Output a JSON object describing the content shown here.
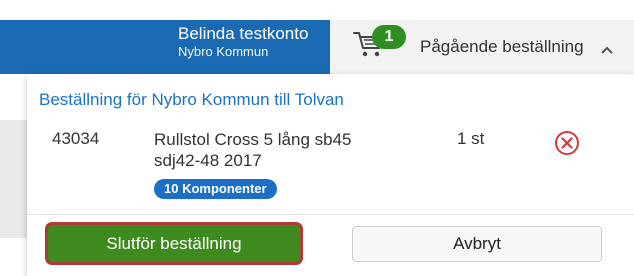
{
  "header": {
    "account_name": "Belinda testkonto",
    "account_org": "Nybro Kommun",
    "cart_count": "1",
    "order_status": "Pågående beställning",
    "accent_color": "#1a6ab3"
  },
  "order": {
    "title": "Beställning för Nybro Kommun till Tolvan",
    "items": [
      {
        "id": "43034",
        "description": "Rullstol Cross 5 lång sb45 sdj42-48 2017",
        "quantity": "1 st",
        "components": "10 Komponenter"
      }
    ],
    "actions": {
      "complete_label": "Slutför beställning",
      "cancel_label": "Avbryt"
    }
  },
  "icons": {
    "cart": "cart-icon",
    "remove": "remove-circle-icon",
    "chevron": "chevron-up-icon"
  }
}
